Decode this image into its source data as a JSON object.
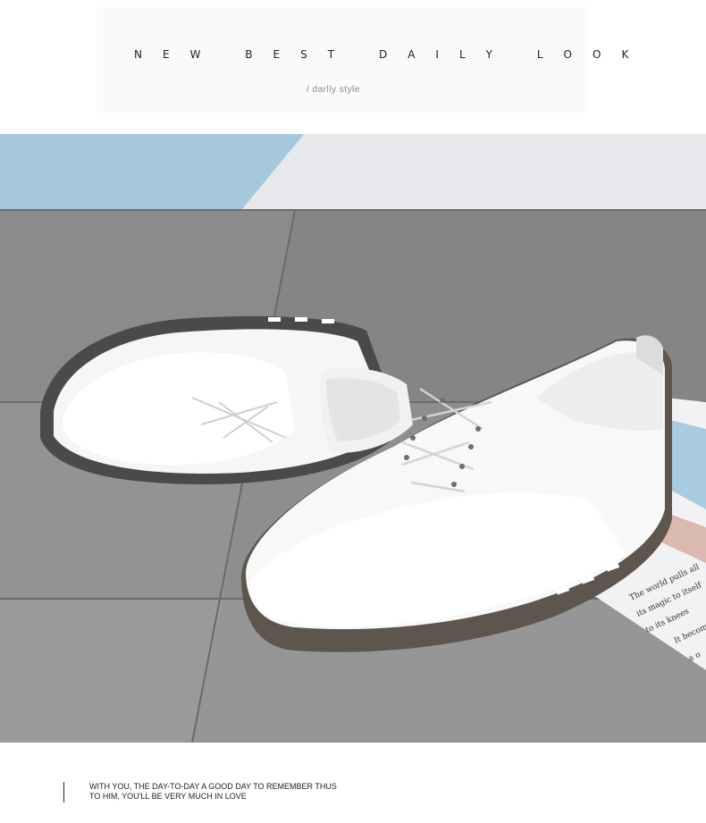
{
  "header": {
    "headline": "NEW BEST DAILY LOOK",
    "subline": "/ darlly style"
  },
  "photo": {
    "paper_text": [
      "The world pulls all",
      "its magic to itself",
      "to its knees",
      "It become",
      "a o"
    ]
  },
  "footer": {
    "line1": "WITH YOU, THE DAY-TO-DAY A GOOD DAY TO REMEMBER THUS",
    "line2": "TO HIM, YOU'LL BE VERY MUCH IN LOVE"
  }
}
